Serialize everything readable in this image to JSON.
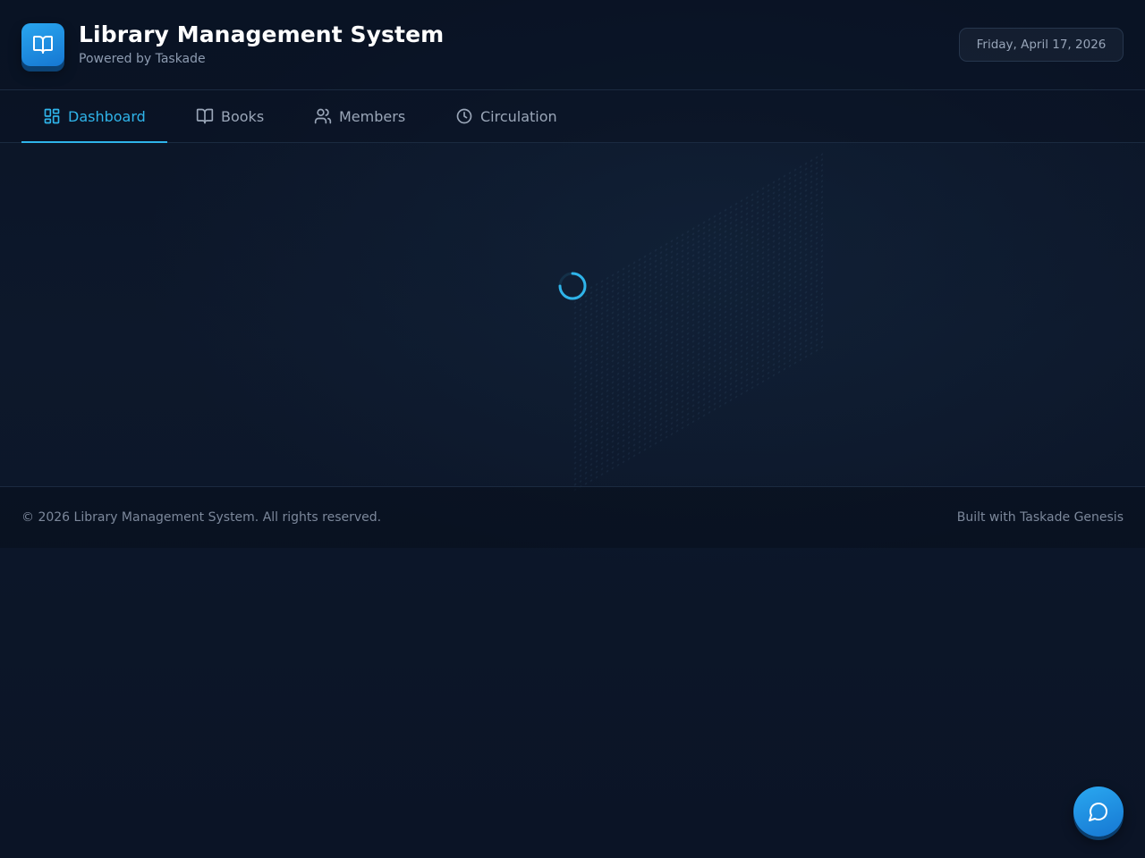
{
  "header": {
    "title": "Library Management System",
    "subtitle": "Powered by Taskade",
    "date": "Friday, April 17, 2026",
    "logo_icon": "book-open-icon"
  },
  "nav": {
    "tabs": [
      {
        "label": "Dashboard",
        "icon": "dashboard-grid-icon",
        "active": true
      },
      {
        "label": "Books",
        "icon": "book-open-icon",
        "active": false
      },
      {
        "label": "Members",
        "icon": "users-icon",
        "active": false
      },
      {
        "label": "Circulation",
        "icon": "clock-icon",
        "active": false
      }
    ]
  },
  "main": {
    "state": "loading"
  },
  "footer": {
    "copyright": "© 2026 Library Management System. All rights reserved.",
    "built_with": "Built with Taskade Genesis"
  },
  "chat": {
    "icon": "chat-bubble-icon"
  },
  "colors": {
    "accent": "#2fb4ea",
    "brand": "#1677d2",
    "background": "#0c1628",
    "muted_text": "#9aa6b8"
  }
}
